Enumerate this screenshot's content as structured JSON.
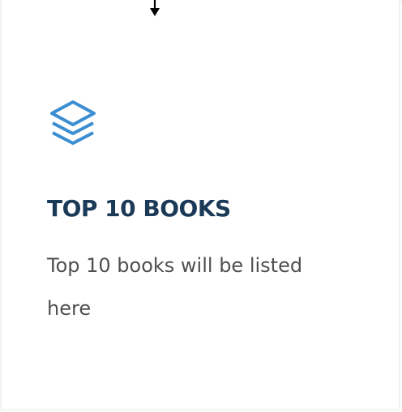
{
  "card": {
    "icon": "layers-icon",
    "title": "TOP 10 BOOKS",
    "description": "Top 10 books will be listed here"
  },
  "colors": {
    "accent": "#3b8ed1",
    "title": "#1b3a57",
    "text": "#505050"
  },
  "cursor": "arrow-cursor-icon"
}
